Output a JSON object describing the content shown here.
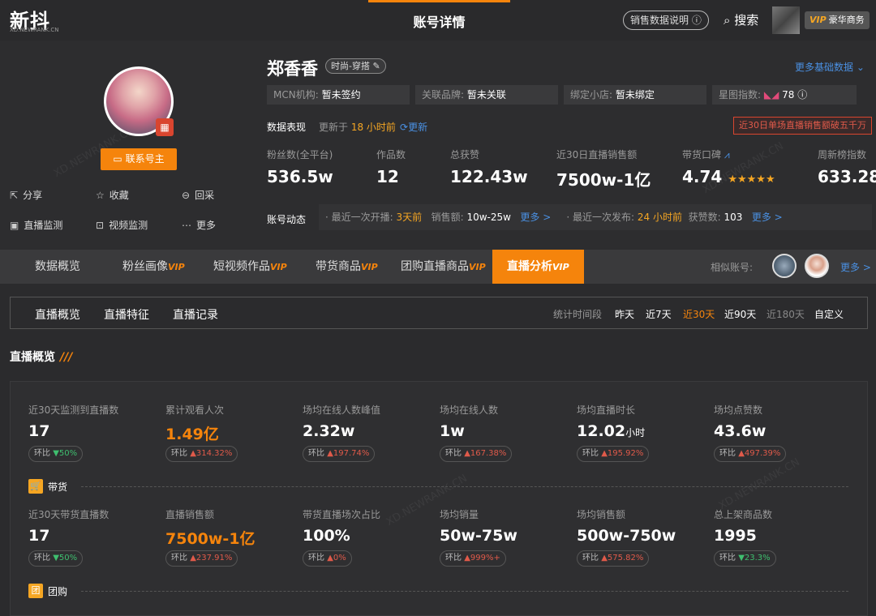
{
  "header": {
    "logo": "新抖",
    "logo_sub": "XD.NEWRANK.CN",
    "title": "账号详情",
    "explain_btn": "销售数据说明",
    "search": "搜索",
    "vip_badge": "VIP",
    "vip_label": "豪华商务"
  },
  "profile": {
    "name": "郑香香",
    "tag": "时尚-穿搭",
    "more_basic": "更多基础数据",
    "contact_btn": "联系号主",
    "actions": [
      {
        "label": "分享",
        "icon": "share-icon"
      },
      {
        "label": "收藏",
        "icon": "star-icon"
      },
      {
        "label": "回采",
        "icon": "refresh-icon"
      },
      {
        "label": "直播监测",
        "icon": "live-icon"
      },
      {
        "label": "视频监测",
        "icon": "chart-icon"
      },
      {
        "label": "更多",
        "icon": "more-icon"
      }
    ],
    "info": [
      {
        "label": "MCN机构: ",
        "value": "暂未签约"
      },
      {
        "label": "关联品牌: ",
        "value": "暂未关联"
      },
      {
        "label": "绑定小店: ",
        "value": "暂未绑定"
      },
      {
        "label": "星图指数: ",
        "value": "78"
      }
    ],
    "perf_label": "数据表现",
    "updated_prefix": "更新于",
    "updated_value": "18 小时前",
    "refresh": "更新",
    "alert": "近30日单场直播销售额破五千万",
    "stats": [
      {
        "label": "粉丝数(全平台)",
        "value": "536.5w"
      },
      {
        "label": "作品数",
        "value": "12"
      },
      {
        "label": "总获赞",
        "value": "122.43w"
      },
      {
        "label": "近30日直播销售额",
        "value": "7500w-1亿"
      },
      {
        "label": "带货口碑",
        "value": "4.74"
      },
      {
        "label": "周新榜指数",
        "value": "633.28"
      }
    ],
    "dyn_label": "账号动态",
    "dyn": {
      "live_prefix": "· 最近一次开播: ",
      "live_time": "3天前",
      "sales_label": "销售额: ",
      "sales": "10w-25w",
      "more1": "更多 >",
      "post_prefix": "· 最近一次发布: ",
      "post_time": "24 小时前",
      "likes_label": "获赞数: ",
      "likes": "103",
      "more2": "更多 >"
    }
  },
  "nav": {
    "tabs": [
      {
        "label": "数据概览",
        "vip": ""
      },
      {
        "label": "粉丝画像",
        "vip": "VIP"
      },
      {
        "label": "短视频作品",
        "vip": "VIP"
      },
      {
        "label": "带货商品",
        "vip": "VIP"
      },
      {
        "label": "团购直播商品",
        "vip": "VIP"
      },
      {
        "label": "直播分析",
        "vip": "VIP"
      }
    ],
    "similar": "相似账号:",
    "more": "更多 >"
  },
  "subnav": {
    "tabs": [
      "直播概览",
      "直播特征",
      "直播记录"
    ],
    "range_label": "统计时间段",
    "ranges": [
      "昨天",
      "近7天",
      "近30天",
      "近90天",
      "近180天",
      "自定义"
    ]
  },
  "overview": {
    "title": "直播概览",
    "title_mark": "///",
    "row1": [
      {
        "label": "近30天监测到直播数",
        "value": "17",
        "ratio": "50%",
        "dir": "dn"
      },
      {
        "label": "累计观看人次",
        "value": "1.49亿",
        "ratio": "314.32%",
        "dir": "up"
      },
      {
        "label": "场均在线人数峰值",
        "value": "2.32w",
        "ratio": "197.74%",
        "dir": "up"
      },
      {
        "label": "场均在线人数",
        "value": "1w",
        "ratio": "167.38%",
        "dir": "up"
      },
      {
        "label": "场均直播时长",
        "value": "12.02",
        "unit": "小时",
        "ratio": "195.92%",
        "dir": "up"
      },
      {
        "label": "场均点赞数",
        "value": "43.6w",
        "ratio": "497.39%",
        "dir": "up"
      }
    ],
    "cat1": "带货",
    "cat1_icon": "🛒",
    "row2": [
      {
        "label": "近30天带货直播数",
        "value": "17",
        "ratio": "50%",
        "dir": "dn"
      },
      {
        "label": "直播销售额",
        "value": "7500w-1亿",
        "ratio": "237.91%",
        "dir": "up"
      },
      {
        "label": "带货直播场次占比",
        "value": "100%",
        "ratio": "0%",
        "dir": "up"
      },
      {
        "label": "场均销量",
        "value": "50w-75w",
        "ratio": "999%+",
        "dir": "up"
      },
      {
        "label": "场均销售额",
        "value": "500w-750w",
        "ratio": "575.82%",
        "dir": "up"
      },
      {
        "label": "总上架商品数",
        "value": "1995",
        "ratio": "23.3%",
        "dir": "dn"
      }
    ],
    "cat2": "团购",
    "cat2_icon": "团",
    "ratio_label": "环比"
  },
  "colors": {
    "accent": "#f5840c",
    "link": "#4a90e2",
    "up": "#e05a4a",
    "down": "#3fbf6f"
  }
}
